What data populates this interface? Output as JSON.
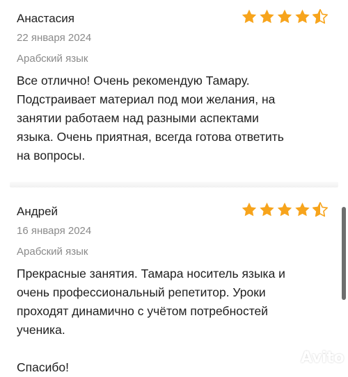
{
  "reviews": [
    {
      "author": "Анастасия",
      "date": "22 января 2024",
      "subject": "Арабский язык",
      "text": "Все отлично! Очень рекомендую Тамару.\nПодстраивает материал под мои желания, на\nзанятии работаем над разными аспектами\nязыка. Очень приятная, всегда готова ответить\nна вопросы.",
      "rating": 4.5,
      "rating_max": 5
    },
    {
      "author": "Андрей",
      "date": "16 января 2024",
      "subject": "Арабский язык",
      "text": "Прекрасные занятия. Тамара носитель языка и\nочень профессиональный репетитор. Уроки\nпроходят динамично с учётом потребностей\nученика.\n\nСпасибо!",
      "rating": 4.5,
      "rating_max": 5
    }
  ],
  "colors": {
    "star": "#f7a41c",
    "text": "#1f1f1f",
    "muted": "#8a8a8a"
  },
  "watermark": {
    "text": "Avito",
    "icon": "avito-logo-icon"
  }
}
